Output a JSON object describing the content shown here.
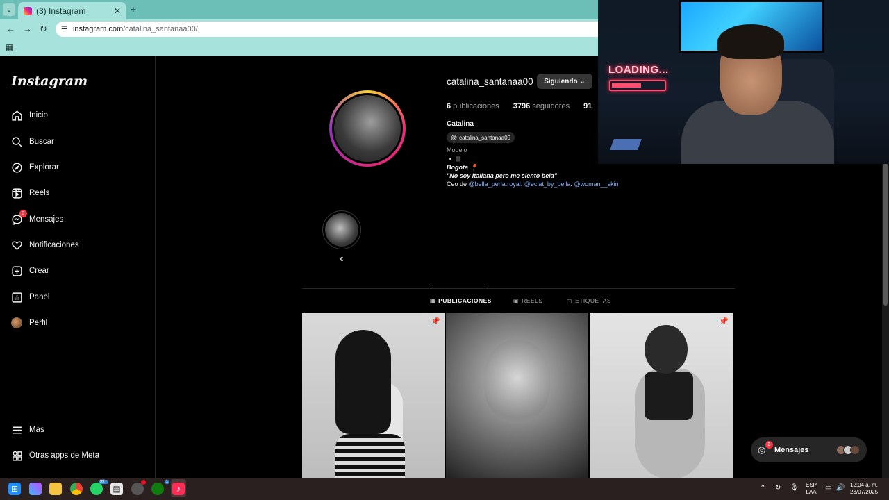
{
  "browser": {
    "tab_title": "(3) Instagram",
    "url_host": "instagram.com",
    "url_path": "/catalina_santanaa00/"
  },
  "sidebar": {
    "logo": "Instagram",
    "items": [
      {
        "label": "Inicio",
        "icon": "home-icon"
      },
      {
        "label": "Buscar",
        "icon": "search-icon"
      },
      {
        "label": "Explorar",
        "icon": "compass-icon"
      },
      {
        "label": "Reels",
        "icon": "reels-icon"
      },
      {
        "label": "Mensajes",
        "icon": "messenger-icon",
        "badge": "3"
      },
      {
        "label": "Notificaciones",
        "icon": "heart-icon"
      },
      {
        "label": "Crear",
        "icon": "plus-square-icon"
      },
      {
        "label": "Panel",
        "icon": "chart-icon"
      },
      {
        "label": "Perfil",
        "icon": "avatar"
      }
    ],
    "more": "Más",
    "meta_apps": "Otras apps de Meta"
  },
  "profile": {
    "username": "catalina_santanaa00",
    "follow_button": "Siguiendo",
    "posts_count": "6",
    "posts_label": "publicaciones",
    "followers_count": "3796",
    "followers_label": "seguidores",
    "following_count": "91",
    "full_name": "Catalina",
    "threads_handle": "catalina_santanaa00",
    "category": "Modelo",
    "bio_line1": "▫️◼️",
    "bio_line2": "Bogota 📍",
    "bio_line3": "\"No soy italiana pero me siento bela\"",
    "bio_ceo": "Ceo de ",
    "bio_link1": "@bella_perla.royal",
    "bio_link2": "@eclat_by_bella",
    "bio_link3": "@woman__skin",
    "highlight_label": "€"
  },
  "tabs": [
    {
      "label": "PUBLICACIONES",
      "icon": "grid-icon",
      "active": true
    },
    {
      "label": "REELS",
      "icon": "reels-icon",
      "active": false
    },
    {
      "label": "ETIQUETAS",
      "icon": "tag-icon",
      "active": false
    }
  ],
  "messages_pill": {
    "label": "Mensajes",
    "badge": "3"
  },
  "webcam": {
    "neon_text": "LOADING..."
  },
  "taskbar": {
    "whatsapp_badge": "99+",
    "xbox_badge": "1",
    "lang_top": "ESP",
    "lang_bottom": "LAA",
    "time": "12:04 a. m.",
    "date": "23/07/2025"
  }
}
